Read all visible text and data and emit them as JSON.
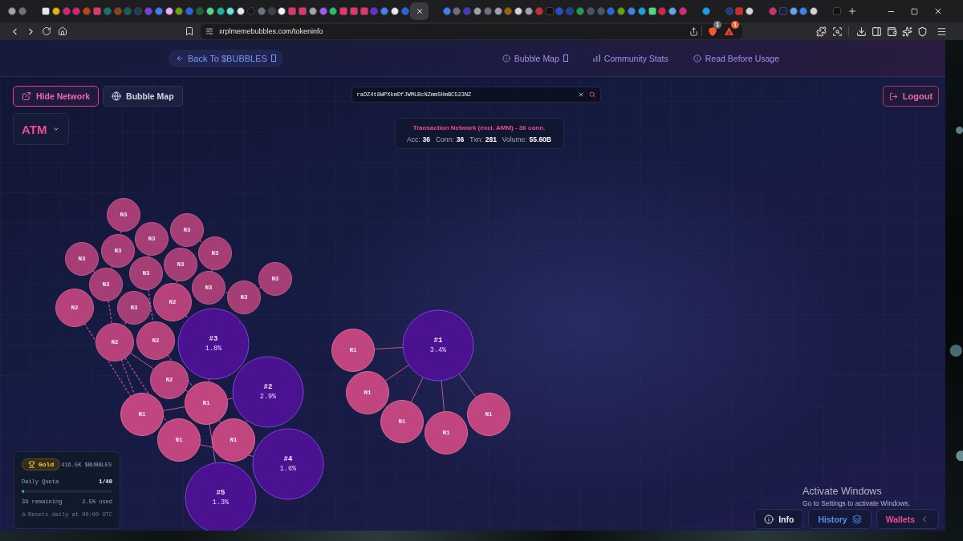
{
  "browser": {
    "tab_groups": [
      {
        "tabs": [
          {
            "kind": "circle",
            "color": "#9ca3af",
            "selected": false
          },
          {
            "kind": "circle",
            "color": "#6b7280",
            "selected": false
          }
        ]
      },
      {
        "tabs": [
          {
            "kind": "square",
            "color": "#e5e7eb",
            "selected": false
          },
          {
            "kind": "circle",
            "color": "#eab308",
            "selected": false
          },
          {
            "kind": "circle",
            "color": "#e11d74",
            "selected": false
          },
          {
            "kind": "circle",
            "color": "#e11d74",
            "selected": false
          },
          {
            "kind": "circle",
            "color": "#c2410c",
            "selected": false
          },
          {
            "kind": "square",
            "color": "#e6336f",
            "selected": false
          },
          {
            "kind": "circle",
            "color": "#0f766e",
            "selected": false
          },
          {
            "kind": "circle",
            "color": "#92400e",
            "selected": false
          },
          {
            "kind": "circle",
            "color": "#115e59",
            "selected": false
          },
          {
            "kind": "circle",
            "color": "#1e3a5f",
            "selected": false
          },
          {
            "kind": "circle",
            "color": "#7c3aed",
            "selected": false
          },
          {
            "kind": "circle",
            "color": "#3b82f6",
            "selected": false
          },
          {
            "kind": "circle",
            "color": "#f0abfc",
            "selected": false
          },
          {
            "kind": "circle",
            "color": "#65a30d",
            "selected": false
          },
          {
            "kind": "circle",
            "color": "#2563eb",
            "selected": false
          },
          {
            "kind": "circle",
            "color": "#166534",
            "selected": false
          },
          {
            "kind": "circle",
            "color": "#4ade80",
            "selected": false
          },
          {
            "kind": "circle",
            "color": "#14b8a6",
            "selected": false
          },
          {
            "kind": "circle",
            "color": "#5eead4",
            "selected": false
          },
          {
            "kind": "circle",
            "color": "#e5e5e5",
            "selected": false
          },
          {
            "kind": "circle",
            "color": "#111827",
            "selected": false
          },
          {
            "kind": "circle",
            "color": "#6b7280",
            "selected": false
          },
          {
            "kind": "circle",
            "color": "#374151",
            "selected": false
          },
          {
            "kind": "circle",
            "color": "#f5f5f5",
            "selected": false
          },
          {
            "kind": "square",
            "color": "#e6336f",
            "selected": false
          },
          {
            "kind": "square",
            "color": "#e6336f",
            "selected": false
          },
          {
            "kind": "circle",
            "color": "#9ca3af",
            "selected": false
          },
          {
            "kind": "circle",
            "color": "#a855f7",
            "selected": false
          },
          {
            "kind": "circle",
            "color": "#22c55e",
            "selected": false
          },
          {
            "kind": "square",
            "color": "#e6336f",
            "selected": false
          },
          {
            "kind": "square",
            "color": "#e6336f",
            "selected": false
          },
          {
            "kind": "square",
            "color": "#e6336f",
            "selected": false
          },
          {
            "kind": "circle",
            "color": "#6d28d9",
            "selected": false
          },
          {
            "kind": "circle",
            "color": "#3b82f6",
            "selected": false
          },
          {
            "kind": "circle",
            "color": "#e5e7eb",
            "selected": false
          },
          {
            "kind": "circle",
            "color": "#2563eb",
            "selected": false
          },
          {
            "selected": true
          }
        ]
      },
      {
        "tabs": [
          {
            "kind": "circle",
            "color": "#3b82f6",
            "selected": false
          },
          {
            "kind": "circle",
            "color": "#6b7280",
            "selected": false
          },
          {
            "kind": "circle",
            "color": "#4338ca",
            "selected": false
          },
          {
            "kind": "circle",
            "color": "#9ca3af",
            "selected": false
          },
          {
            "kind": "circle",
            "color": "#6b7280",
            "selected": false
          },
          {
            "kind": "circle",
            "color": "#9ca3af",
            "selected": false
          },
          {
            "kind": "circle",
            "color": "#a16207",
            "selected": false
          },
          {
            "kind": "circle",
            "color": "#d1d5db",
            "selected": false
          },
          {
            "kind": "circle",
            "color": "#9ca3af",
            "selected": false
          },
          {
            "kind": "circle",
            "color": "#dc2626",
            "selected": false
          },
          {
            "kind": "square",
            "color": "#111111",
            "selected": false
          },
          {
            "kind": "circle",
            "color": "#1d4ed8",
            "selected": false
          },
          {
            "kind": "circle",
            "color": "#1e40af",
            "selected": false
          },
          {
            "kind": "circle",
            "color": "#16a34a",
            "selected": false
          },
          {
            "kind": "circle",
            "color": "#4b5563",
            "selected": false
          },
          {
            "kind": "circle",
            "color": "#4b5563",
            "selected": false
          },
          {
            "kind": "circle",
            "color": "#2563eb",
            "selected": false
          },
          {
            "kind": "circle",
            "color": "#65a30d",
            "selected": false
          },
          {
            "kind": "circle",
            "color": "#3b82f6",
            "selected": false
          },
          {
            "kind": "circle",
            "color": "#0ea5e9",
            "selected": false
          },
          {
            "kind": "square",
            "color": "#4ade80",
            "selected": false
          },
          {
            "kind": "circle",
            "color": "#e11d48",
            "selected": false
          },
          {
            "kind": "circle",
            "color": "#60a5fa",
            "selected": false
          },
          {
            "kind": "circle",
            "color": "#db2777",
            "selected": false
          }
        ]
      },
      {
        "tabs": [
          {
            "kind": "circle",
            "color": "#0ea5e9",
            "selected": false
          }
        ]
      },
      {
        "tabs": [
          {
            "kind": "circle",
            "color": "#1e3a8a",
            "selected": false
          },
          {
            "kind": "square",
            "color": "#dc2626",
            "selected": false
          },
          {
            "kind": "circle",
            "color": "#d1d5db",
            "selected": false
          }
        ]
      },
      {
        "tabs": [
          {
            "kind": "circle",
            "color": "#db2777",
            "selected": false
          },
          {
            "kind": "square",
            "color": "#1e1b4b",
            "selected": false
          },
          {
            "kind": "circle",
            "color": "#60a5fa",
            "selected": false
          },
          {
            "kind": "circle",
            "color": "#3b82f6",
            "selected": false
          },
          {
            "kind": "circle",
            "color": "#d6d3d1",
            "selected": false
          }
        ]
      },
      {
        "tabs": [
          {
            "kind": "square",
            "color": "#111111",
            "selected": false
          }
        ]
      }
    ],
    "url": "xrplmemebubbles.com/tokeninfo",
    "shields_badge": "1",
    "rewards_badge": "1"
  },
  "header": {
    "back_link": {
      "label": "Back To $BUBBLES",
      "external": true
    },
    "nav": [
      {
        "label": "Bubble Map",
        "kind": "info",
        "external": true
      },
      {
        "label": "Community Stats",
        "kind": "stats",
        "external": false
      },
      {
        "label": "Read Before Usage",
        "kind": "info",
        "external": false
      }
    ]
  },
  "toolbar": {
    "view_buttons": [
      {
        "label": "Hide Network",
        "kind": "network",
        "selected": true
      },
      {
        "label": "Bubble Map",
        "kind": "map",
        "selected": false
      }
    ],
    "search": {
      "value": "raDZ4t8WPXkmDfJWMLBcNZmmSHmBC523NZ"
    },
    "logout": "Logout"
  },
  "token_selector": "ATM",
  "network_stats": {
    "title": "Transaction Network (excl. AMM) - 36 conn.",
    "items": [
      {
        "label": "Acc:",
        "value": "36"
      },
      {
        "label": "Conn:",
        "value": "36"
      },
      {
        "label": "Txn:",
        "value": "281"
      },
      {
        "label": "Volume:",
        "value": "55.60B"
      }
    ]
  },
  "graph": {
    "nodes": [
      {
        "kind": "third",
        "label": "N3"
      },
      {
        "kind": "third",
        "label": "N3"
      },
      {
        "kind": "third",
        "label": "N3"
      },
      {
        "kind": "third",
        "label": "N3"
      },
      {
        "kind": "third",
        "label": "N3"
      },
      {
        "kind": "third",
        "label": "N3"
      },
      {
        "kind": "third",
        "label": "N3"
      },
      {
        "kind": "third",
        "label": "N3"
      },
      {
        "kind": "third",
        "label": "N3"
      },
      {
        "kind": "third",
        "label": "N3"
      },
      {
        "kind": "third",
        "label": "N3"
      },
      {
        "kind": "third",
        "label": "N3"
      },
      {
        "kind": "second",
        "label": "N2"
      },
      {
        "kind": "second",
        "label": "N2"
      },
      {
        "kind": "third",
        "label": "N3"
      },
      {
        "kind": "second",
        "label": "N2"
      },
      {
        "kind": "second",
        "label": "N2"
      },
      {
        "kind": "holder",
        "label": "#3",
        "share": "1.8%"
      },
      {
        "kind": "first",
        "label": "N1"
      },
      {
        "kind": "holder",
        "label": "#1",
        "share": "3.4%"
      },
      {
        "kind": "second",
        "label": "N2"
      },
      {
        "kind": "holder",
        "label": "#2",
        "share": "2.9%"
      },
      {
        "kind": "first",
        "label": "N1"
      },
      {
        "kind": "first",
        "label": "N1"
      },
      {
        "kind": "first",
        "label": "N1"
      },
      {
        "kind": "first",
        "label": "N1"
      },
      {
        "kind": "first",
        "label": "N1"
      },
      {
        "kind": "first",
        "label": "N1"
      },
      {
        "kind": "first",
        "label": "N1"
      },
      {
        "kind": "first",
        "label": "N1"
      },
      {
        "kind": "holder",
        "label": "#4",
        "share": "1.6%"
      },
      {
        "kind": "holder",
        "label": "#5",
        "share": "1.3%"
      }
    ]
  },
  "quota": {
    "tier": "Gold",
    "balance": "416.5K $BUBBLES",
    "title": "Daily Quota",
    "count": "1/40",
    "level": 0.025,
    "remaining": "39 remaining",
    "used": "2.5% used",
    "reset": "Resets daily at 00:00 UTC"
  },
  "bottom_buttons": [
    {
      "label": "Info",
      "kind": "info"
    },
    {
      "label": "History",
      "kind": "history"
    },
    {
      "label": "Wallets",
      "kind": "wallets"
    }
  ],
  "activation_notice": {
    "title": "Activate Windows",
    "text": "Go to Settings to activate Windows."
  }
}
